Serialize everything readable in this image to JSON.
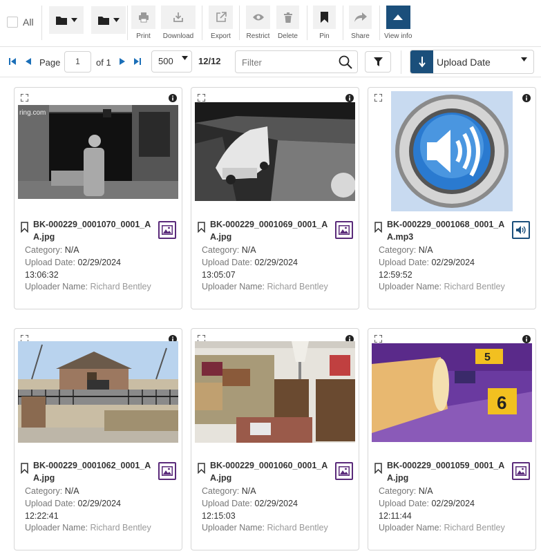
{
  "toolbar": {
    "all_label": "All",
    "buttons": [
      {
        "label": "Print",
        "icon": "print-icon"
      },
      {
        "label": "Download",
        "icon": "download-icon"
      },
      {
        "label": "Export",
        "icon": "export-icon"
      },
      {
        "label": "Restrict",
        "icon": "eye-icon"
      },
      {
        "label": "Delete",
        "icon": "trash-icon"
      },
      {
        "label": "Pin",
        "icon": "pin-bookmark-icon"
      },
      {
        "label": "Share",
        "icon": "share-arrow-icon"
      },
      {
        "label": "View info",
        "icon": "caret-up-icon"
      }
    ]
  },
  "pager": {
    "page_label": "Page",
    "page_value": "1",
    "of_label": "of 1",
    "page_size": "500",
    "count": "12/12",
    "filter_placeholder": "Filter",
    "sort_label": "Upload Date"
  },
  "colors": {
    "accent": "#1b4f7b",
    "image_type": "#5a2a7a"
  },
  "meta_labels": {
    "category": "Category:",
    "upload_date": "Upload Date:",
    "uploader": "Uploader Name:"
  },
  "cards": [
    {
      "name_line1": "BK-000229_0001070_0001_A",
      "name_line2": "A.jpg",
      "category": "N/A",
      "date": "02/29/2024",
      "time": "13:06:32",
      "uploader": "Richard Bentley",
      "type": "image",
      "watermark": "ring.com"
    },
    {
      "name_line1": "BK-000229_0001069_0001_A",
      "name_line2": "A.jpg",
      "category": "N/A",
      "date": "02/29/2024",
      "time": "13:05:07",
      "uploader": "Richard Bentley",
      "type": "image"
    },
    {
      "name_line1": "BK-000229_0001068_0001_A",
      "name_line2": "A.mp3",
      "category": "N/A",
      "date": "02/29/2024",
      "time": "12:59:52",
      "uploader": "Richard Bentley",
      "type": "audio"
    },
    {
      "name_line1": "BK-000229_0001062_0001_A",
      "name_line2": "A.jpg",
      "category": "N/A",
      "date": "02/29/2024",
      "time": "12:22:41",
      "uploader": "Richard Bentley",
      "type": "image"
    },
    {
      "name_line1": "BK-000229_0001060_0001_A",
      "name_line2": "A.jpg",
      "category": "N/A",
      "date": "02/29/2024",
      "time": "12:15:03",
      "uploader": "Richard Bentley",
      "type": "image"
    },
    {
      "name_line1": "BK-000229_0001059_0001_A",
      "name_line2": "A.jpg",
      "category": "N/A",
      "date": "02/29/2024",
      "time": "12:11:44",
      "uploader": "Richard Bentley",
      "type": "image",
      "markers": [
        "5",
        "6"
      ]
    }
  ]
}
